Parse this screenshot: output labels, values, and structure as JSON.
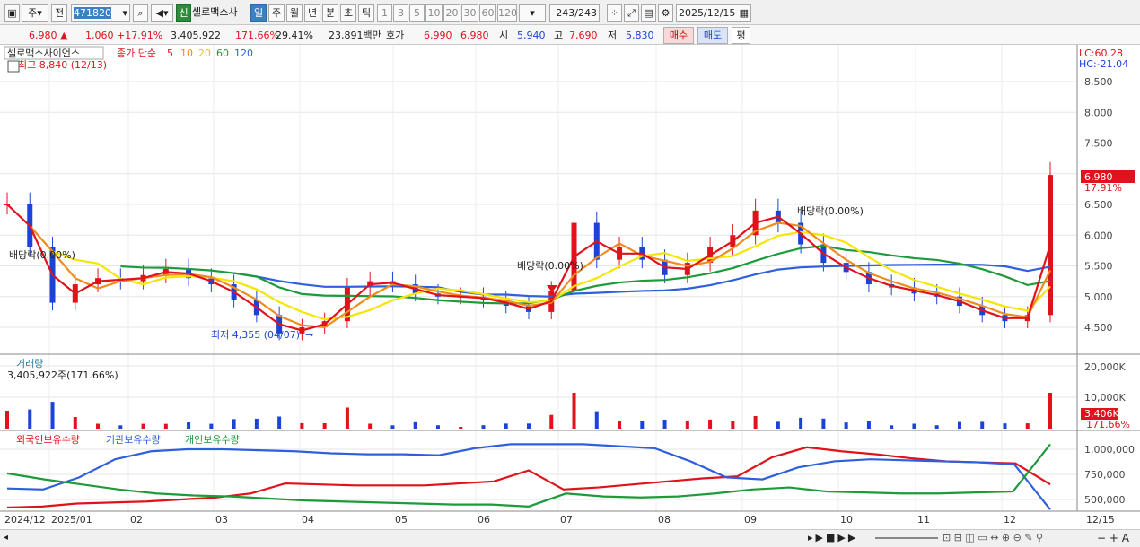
{
  "toolbar": {
    "period_select": "주",
    "prev_label": "전",
    "code_value": "471820",
    "new_label": "신",
    "stock_name": "셀로맥스사",
    "tf": [
      "일",
      "주",
      "월",
      "년",
      "분",
      "초",
      "틱"
    ],
    "intervals": [
      "1",
      "3",
      "5",
      "10",
      "20",
      "30",
      "60",
      "120"
    ],
    "count": "243",
    "count_total": "/243",
    "date": "2025/12/15"
  },
  "quote": {
    "price": "6,980",
    "change": "1,060",
    "change_pct": "+17.91%",
    "volume": "3,405,922",
    "vol_ratio": "171.66%",
    "turnover": "29.41%",
    "amount": "23,891백만",
    "bid_label": "호가",
    "bid1": "6,990",
    "bid2": "6,980",
    "open_label": "시",
    "open": "5,940",
    "high_label": "고",
    "high": "7,690",
    "low_label": "저",
    "low": "5,830",
    "buy": "매수",
    "sell": "매도",
    "avg": "평"
  },
  "price_panel": {
    "stock_label": "셀로맥스사이언스",
    "ma_label": "종가 단순",
    "ma_periods": [
      "5",
      "10",
      "20",
      "60",
      "120"
    ],
    "high_note": "최고 8,840 (12/13)",
    "low_note": "최저 4,355 (04/07)",
    "dividend1": "배당락(0.00%)",
    "dividend2": "배당락(0.00%)",
    "dividend3": "배당락(0.00%)",
    "lc": "LC:60.28",
    "hc": "HC:-21.04",
    "y_ticks": [
      "8,500",
      "8,000",
      "7,500",
      "7,000",
      "6,500",
      "6,000",
      "5,500",
      "5,000",
      "4,500"
    ],
    "last_price": "6,980",
    "last_pct": "17.91%"
  },
  "volume_panel": {
    "title": "거래량",
    "value": "3,405,922주(171.66%)",
    "y_ticks": [
      "20,000K",
      "10,000K"
    ],
    "last_vol": "3,406K",
    "last_ratio": "171.66%"
  },
  "holding_panel": {
    "legend": [
      "외국인보유수량",
      "기관보유수량",
      "개인보유수량"
    ],
    "y_ticks": [
      "1,000,000",
      "750,000",
      "500,000"
    ]
  },
  "x_axis": [
    "2024/12",
    "2025/01",
    "02",
    "03",
    "04",
    "05",
    "06",
    "07",
    "08",
    "09",
    "10",
    "11",
    "12",
    "12/15"
  ],
  "colors": {
    "ma5": "#e0121b",
    "ma10": "#f08c1e",
    "ma20": "#f5e600",
    "ma60": "#1e9a3a",
    "ma120": "#2f5fdc",
    "up": "#e0121b",
    "down": "#1b44d6",
    "foreign": "#e0121b",
    "institution": "#2f5fdc",
    "individual": "#1e9a3a"
  },
  "chart_data": {
    "type": "line",
    "title": "",
    "series": [
      {
        "name": "종가",
        "values": [
          6500,
          5800,
          4900,
          5200,
          5300,
          5250,
          5350,
          5450,
          5300,
          5200,
          4950,
          4700,
          4400,
          4500,
          4600,
          5150,
          5250,
          5200,
          5050,
          5000,
          5000,
          4950,
          4850,
          4750,
          5100,
          6200,
          5600,
          5800,
          5600,
          5350,
          5550,
          5800,
          6000,
          6400,
          6200,
          5850,
          5550,
          5400,
          5200,
          5150,
          5050,
          5000,
          4850,
          4700,
          4600,
          4700,
          6980
        ]
      },
      {
        "name": "외국인보유수량",
        "values": [
          420000,
          430000,
          460000,
          470000,
          480000,
          500000,
          520000,
          560000,
          660000,
          650000,
          640000,
          640000,
          640000,
          660000,
          680000,
          790000,
          600000,
          620000,
          650000,
          680000,
          710000,
          730000,
          920000,
          1020000,
          980000,
          950000,
          910000,
          880000,
          870000,
          860000,
          650000
        ]
      },
      {
        "name": "기관보유수량",
        "values": [
          610000,
          600000,
          720000,
          900000,
          980000,
          1000000,
          1000000,
          990000,
          980000,
          960000,
          950000,
          950000,
          940000,
          1010000,
          1050000,
          1050000,
          1050000,
          1030000,
          1010000,
          880000,
          720000,
          700000,
          820000,
          880000,
          900000,
          890000,
          880000,
          870000,
          850000,
          400000
        ]
      },
      {
        "name": "개인보유수량",
        "values": [
          760000,
          700000,
          650000,
          600000,
          560000,
          540000,
          530000,
          510000,
          490000,
          480000,
          470000,
          460000,
          450000,
          450000,
          430000,
          560000,
          530000,
          520000,
          530000,
          560000,
          600000,
          620000,
          580000,
          570000,
          560000,
          560000,
          570000,
          580000,
          1050000
        ]
      }
    ],
    "x": [
      "2024/12",
      "2025/01",
      "02",
      "03",
      "04",
      "05",
      "06",
      "07",
      "08",
      "09",
      "10",
      "11",
      "12",
      "12/15"
    ],
    "ylim": [
      4300,
      8900
    ]
  }
}
